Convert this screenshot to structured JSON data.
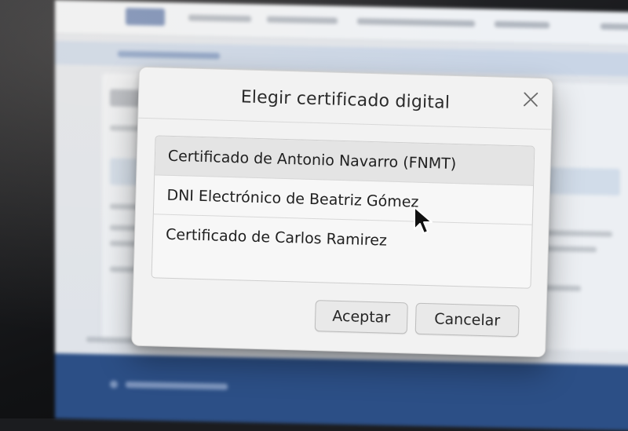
{
  "dialog": {
    "title": "Elegir certificado digital",
    "certificates": [
      {
        "label": "Certificado de Antonio Navarro (FNMT)",
        "selected": true
      },
      {
        "label": "DNI Electrónico de Beatriz Gómez",
        "selected": false
      },
      {
        "label": "Certificado de Carlos Ramirez",
        "selected": false
      }
    ],
    "accept_label": "Aceptar",
    "cancel_label": "Cancelar"
  },
  "icons": {
    "close": "close-icon",
    "cursor": "mouse-pointer-icon"
  },
  "colors": {
    "dialog_bg": "#f2f2f2",
    "selected_row": "#e4e4e4",
    "footer_blue": "#2c4f86"
  }
}
